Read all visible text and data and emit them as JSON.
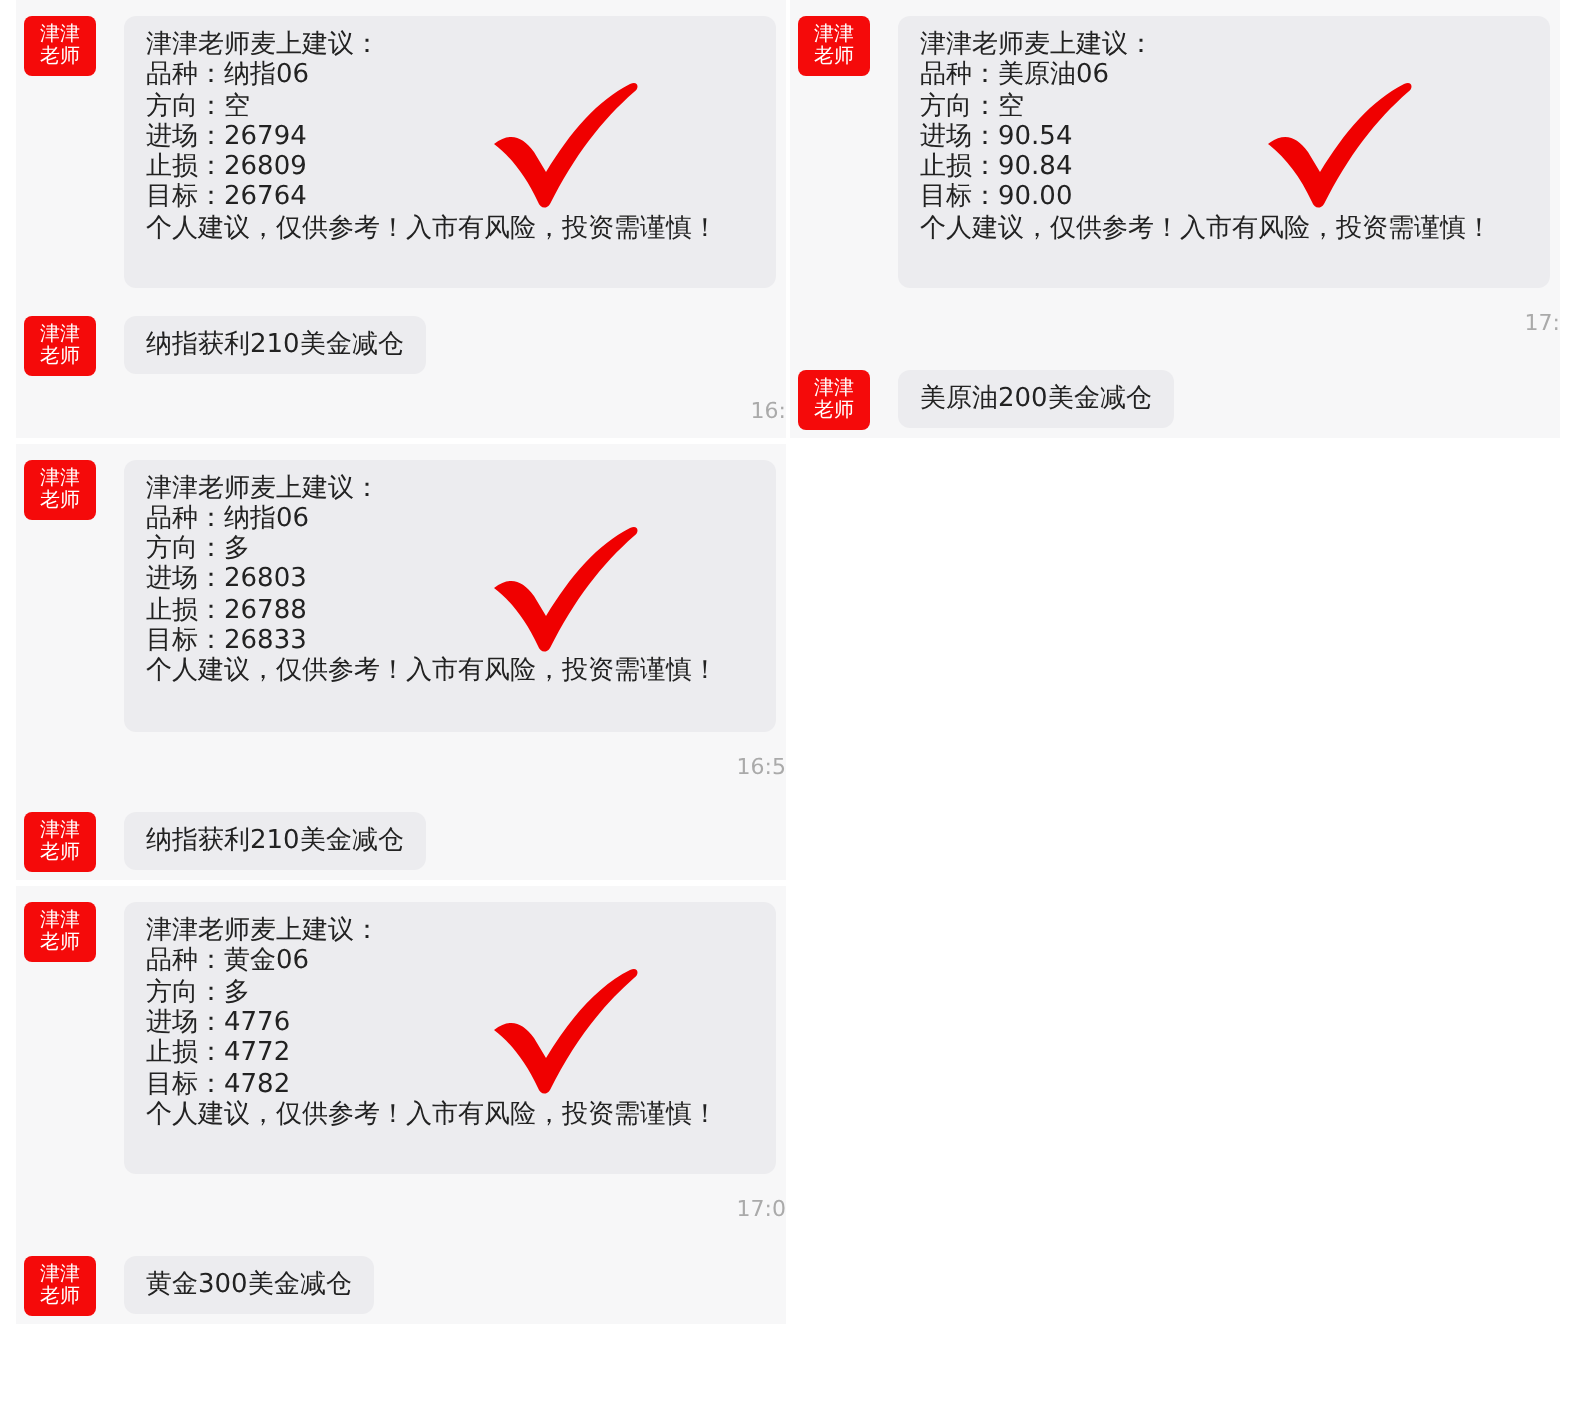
{
  "panels": [
    {
      "messages": [
        {
          "kind": "signal",
          "sender": "津津老师",
          "lines": [
            "津津老师麦上建议：",
            "品种：纳指06",
            "方向：空",
            "进场：26794",
            "止损：26809",
            "目标：26764",
            "个人建议，仅供参考！入市有风险，投资需谨慎！"
          ]
        },
        {
          "kind": "text",
          "sender": "津津老师",
          "text": "纳指获利210美金减仓"
        },
        {
          "kind": "time",
          "text": "16:"
        }
      ]
    },
    {
      "messages": [
        {
          "kind": "signal",
          "sender": "津津老师",
          "lines": [
            "津津老师麦上建议：",
            "品种：纳指06",
            "方向：多",
            "进场：26803",
            "止损：26788",
            "目标：26833",
            "个人建议，仅供参考！入市有风险，投资需谨慎！"
          ]
        },
        {
          "kind": "time",
          "text": "16:5"
        },
        {
          "kind": "text",
          "sender": "津津老师",
          "text": "纳指获利210美金减仓"
        }
      ]
    },
    {
      "messages": [
        {
          "kind": "signal",
          "sender": "津津老师",
          "lines": [
            "津津老师麦上建议：",
            "品种：黄金06",
            "方向：多",
            "进场：4776",
            "止损：4772",
            "目标：4782",
            "个人建议，仅供参考！入市有风险，投资需谨慎！"
          ]
        },
        {
          "kind": "time",
          "text": "17:0"
        },
        {
          "kind": "text",
          "sender": "津津老师",
          "text": "黄金300美金减仓"
        }
      ]
    },
    {
      "messages": [
        {
          "kind": "signal",
          "sender": "津津老师",
          "lines": [
            "津津老师麦上建议：",
            "品种：美原油06",
            "方向：空",
            "进场：90.54",
            "止损：90.84",
            "目标：90.00",
            "个人建议，仅供参考！入市有风险，投资需谨慎！"
          ]
        },
        {
          "kind": "time",
          "text": "17:"
        },
        {
          "kind": "text",
          "sender": "津津老师",
          "text": "美原油200美金减仓"
        }
      ]
    }
  ]
}
